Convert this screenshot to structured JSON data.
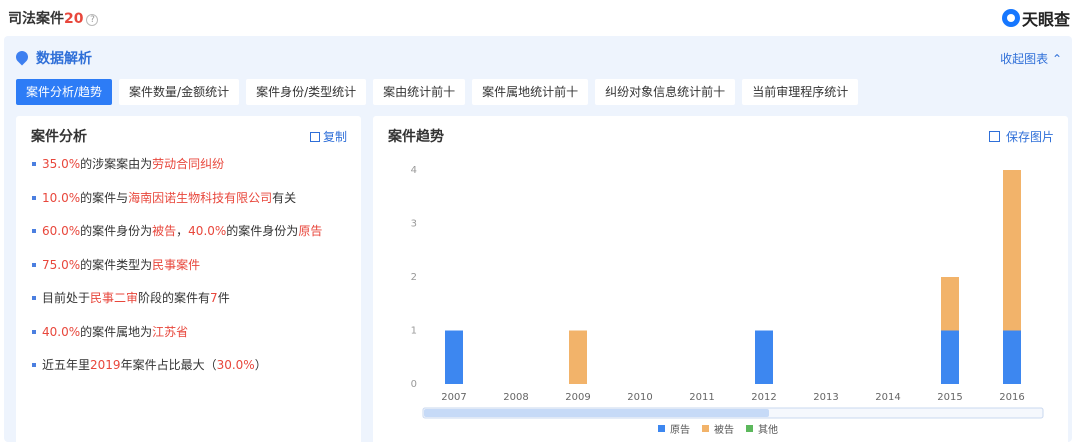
{
  "header": {
    "title": "司法案件",
    "count": "20",
    "help": "?",
    "brand": "天眼查"
  },
  "panel": {
    "title": "数据解析",
    "collapse_label": "收起图表",
    "tabs": [
      {
        "label": "案件分析/趋势",
        "active": true
      },
      {
        "label": "案件数量/金额统计"
      },
      {
        "label": "案件身份/类型统计"
      },
      {
        "label": "案由统计前十"
      },
      {
        "label": "案件属地统计前十"
      },
      {
        "label": "纠纷对象信息统计前十"
      },
      {
        "label": "当前审理程序统计"
      }
    ]
  },
  "analysis": {
    "title": "案件分析",
    "copy_label": "复制",
    "items": [
      [
        {
          "t": "35.0%",
          "h": true
        },
        {
          "t": "的涉案案由为"
        },
        {
          "t": "劳动合同纠纷",
          "h": true
        }
      ],
      [
        {
          "t": "10.0%",
          "h": true
        },
        {
          "t": "的案件与"
        },
        {
          "t": "海南因诺生物科技有限公司",
          "h": true
        },
        {
          "t": "有关"
        }
      ],
      [
        {
          "t": "60.0%",
          "h": true
        },
        {
          "t": "的案件身份为"
        },
        {
          "t": "被告",
          "h": true
        },
        {
          "t": "，"
        },
        {
          "t": "40.0%",
          "h": true
        },
        {
          "t": "的案件身份为"
        },
        {
          "t": "原告",
          "h": true
        }
      ],
      [
        {
          "t": "75.0%",
          "h": true
        },
        {
          "t": "的案件类型为"
        },
        {
          "t": "民事案件",
          "h": true
        }
      ],
      [
        {
          "t": "目前处于"
        },
        {
          "t": "民事二审",
          "h": true
        },
        {
          "t": "阶段的案件有"
        },
        {
          "t": "7",
          "h": true
        },
        {
          "t": "件"
        }
      ],
      [
        {
          "t": "40.0%",
          "h": true
        },
        {
          "t": "的案件属地为"
        },
        {
          "t": "江苏省",
          "h": true
        }
      ],
      [
        {
          "t": "近五年里"
        },
        {
          "t": "2019",
          "h": true
        },
        {
          "t": "年案件占比最大（"
        },
        {
          "t": "30.0%",
          "h": true
        },
        {
          "t": "）"
        }
      ]
    ]
  },
  "trend": {
    "title": "案件趋势",
    "save_label": "保存图片"
  },
  "colors": {
    "plaintiff": "#3d87f0",
    "defendant": "#f2b36a",
    "other": "#5cb85c",
    "highlight": "#e8473c"
  },
  "chart_data": {
    "type": "bar",
    "stacked": true,
    "categories": [
      "2007",
      "2008",
      "2009",
      "2010",
      "2011",
      "2012",
      "2013",
      "2014",
      "2015",
      "2016"
    ],
    "series": [
      {
        "name": "原告",
        "values": [
          1,
          0,
          0,
          0,
          0,
          1,
          0,
          0,
          1,
          1
        ]
      },
      {
        "name": "被告",
        "values": [
          0,
          0,
          1,
          0,
          0,
          0,
          0,
          0,
          1,
          3
        ]
      },
      {
        "name": "其他",
        "values": [
          0,
          0,
          0,
          0,
          0,
          0,
          0,
          0,
          0,
          0
        ]
      }
    ],
    "ylim": [
      0,
      4
    ],
    "yticks": [
      "0",
      "1",
      "2",
      "3",
      "4"
    ],
    "legend_position": "bottom",
    "grid": false,
    "xlabel": "",
    "ylabel": ""
  }
}
